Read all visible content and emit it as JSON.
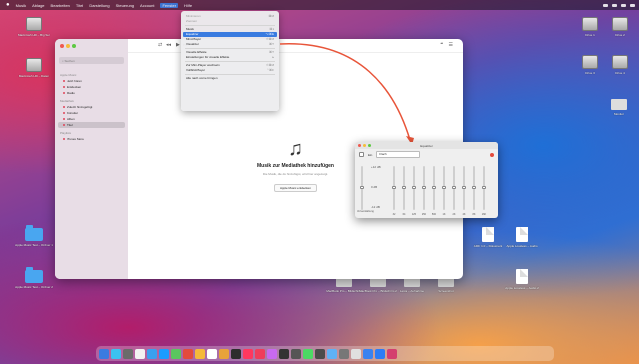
{
  "menubar": {
    "apple": "",
    "items": [
      "Musik",
      "Ablage",
      "Bearbeiten",
      "Titel",
      "Darstellung",
      "Steuerung",
      "Account",
      "Fenster",
      "Hilfe"
    ],
    "active_index": 7
  },
  "desktop_left": [
    {
      "kind": "drive",
      "label": "Macintosh HD – Big Sur"
    },
    {
      "kind": "drive",
      "label": "Macintosh HD – Daten"
    },
    {
      "kind": "folder",
      "label": "Apple Music Test – Ordner 1"
    },
    {
      "kind": "folder",
      "label": "Apple Music Test – Ordner 2"
    }
  ],
  "desktop_right": [
    {
      "kind": "drive",
      "label": "Drive 1"
    },
    {
      "kind": "drive",
      "label": "Drive 2"
    },
    {
      "kind": "drive",
      "label": "Drive 3"
    },
    {
      "kind": "drive",
      "label": "Drive 4"
    },
    {
      "kind": "shape",
      "label": "Monitor"
    }
  ],
  "desktop_files": [
    {
      "kind": "doc",
      "label": "AIFF 1.0 – Dokument"
    },
    {
      "kind": "doc",
      "label": "Apple Lossless – Audio"
    },
    {
      "kind": "doc",
      "label": "Apple Lossless – Audio 2"
    },
    {
      "kind": "shape",
      "label": "MacBook Pro – Bildschirm"
    },
    {
      "kind": "shape",
      "label": "MacBook Pro – Bildschirm 2"
    },
    {
      "kind": "shape",
      "label": "Leica – Aufnahme"
    },
    {
      "kind": "shape",
      "label": "Screenshot"
    }
  ],
  "music": {
    "search_placeholder": "Suchen",
    "sidebar": {
      "sections": [
        {
          "title": "Apple Music",
          "items": [
            "Jetzt hören",
            "Entdecken",
            "Radio"
          ]
        },
        {
          "title": "Mediathek",
          "items": [
            "Zuletzt hinzugefügt",
            "Künstler",
            "Alben",
            "Titel"
          ]
        },
        {
          "title": "Playlists",
          "items": [
            "iTunes Store"
          ]
        }
      ],
      "selected": "Titel"
    },
    "empty_title": "Musik zur Mediathek hinzufügen",
    "empty_body": "Die Musik, die du hinzufügst, wird hier angezeigt.",
    "empty_button": "Apple Music entdecken"
  },
  "menu": {
    "items": [
      {
        "label": "Minimieren",
        "shortcut": "⌘M",
        "state": "disabled"
      },
      {
        "label": "Zoomen",
        "shortcut": "",
        "state": "disabled"
      },
      {
        "sep": true
      },
      {
        "label": "Musik",
        "shortcut": "⌘1",
        "state": "normal"
      },
      {
        "label": "Equalizer",
        "shortcut": "⌥⌘E",
        "state": "highlight"
      },
      {
        "label": "Mini-Player",
        "shortcut": "⇧⌘M",
        "state": "normal"
      },
      {
        "label": "Visualizer",
        "shortcut": "⌘T",
        "state": "normal"
      },
      {
        "sep": true
      },
      {
        "label": "Visuelle Effekte",
        "shortcut": "⌘T",
        "state": "normal"
      },
      {
        "label": "Einstellungen für visuelle Effekte",
        "shortcut": "▸",
        "state": "normal"
      },
      {
        "sep": true
      },
      {
        "label": "Zur Mini-Player wechseln",
        "shortcut": "⇧⌘M",
        "state": "normal"
      },
      {
        "label": "Vollbild-Player",
        "shortcut": "⌃⌘F",
        "state": "normal"
      },
      {
        "sep": true
      },
      {
        "label": "Alle nach vorne bringen",
        "shortcut": "",
        "state": "normal"
      }
    ]
  },
  "equalizer": {
    "title": "Equalizer",
    "enable_label": "Ein",
    "preset": "Flach",
    "db_labels": [
      "+12 dB",
      "0 dB",
      "-12 dB"
    ],
    "preamp_label": "Vorverstärkung",
    "bands": [
      "32",
      "64",
      "125",
      "250",
      "500",
      "1K",
      "2K",
      "4K",
      "8K",
      "16K"
    ],
    "band_levels_db": [
      0,
      0,
      0,
      0,
      0,
      0,
      0,
      0,
      0,
      0
    ],
    "indicator_color": "#e34b3c"
  },
  "dock": {
    "apps": [
      "#3a7be0",
      "#3cc2f0",
      "#6b6b6b",
      "#f2f2f2",
      "#3aa0ef",
      "#1a9cff",
      "#5bc65f",
      "#e34b3c",
      "#f5b93a",
      "#ffffff",
      "#e8a33b",
      "#2d2d2d",
      "#ff375f",
      "#f03d5b",
      "#c86af0",
      "#333333",
      "#555555",
      "#4cd964",
      "#4b4b4b",
      "#5fb1f5",
      "#777777",
      "#e0e0e0",
      "#3a82f0",
      "#2c7cf5",
      "#d43f6e"
    ]
  },
  "colors": {
    "arrow": "#e8553a",
    "accent": "#3a7be0"
  }
}
